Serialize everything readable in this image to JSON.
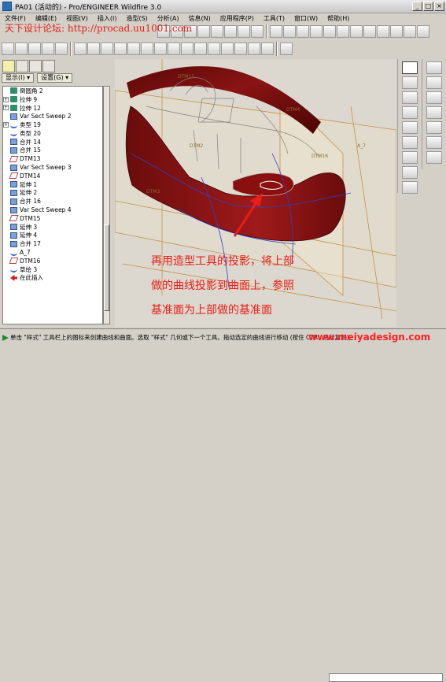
{
  "window": {
    "title": "PA01 (活动的) - Pro/ENGINEER Wildfire 3.0",
    "min_label": "_",
    "max_label": "□",
    "close_label": "×"
  },
  "menu": [
    "文件(F)",
    "编辑(E)",
    "视图(V)",
    "插入(I)",
    "造型(S)",
    "分析(A)",
    "信息(N)",
    "应用程序(P)",
    "工具(T)",
    "窗口(W)",
    "帮助(H)"
  ],
  "watermark_top": "天下设计论坛: http://procad.uu1001.com",
  "panel": {
    "display_label": "显示(I) ▾",
    "settings_label": "设置(G) ▾"
  },
  "tree": [
    {
      "label": "倒圆角 2",
      "icon": "feature-icon",
      "expander": ""
    },
    {
      "label": "拉伸 9",
      "icon": "extrude-icon",
      "expander": "+"
    },
    {
      "label": "拉伸 12",
      "icon": "extrude-icon",
      "expander": "+"
    },
    {
      "label": "Var Sect Sweep 2",
      "icon": "sweep-icon",
      "expander": ""
    },
    {
      "label": "类型 19",
      "icon": "style-icon",
      "expander": "+"
    },
    {
      "label": "类型 20",
      "icon": "style-icon",
      "expander": ""
    },
    {
      "label": "合并 14",
      "icon": "merge-icon",
      "expander": ""
    },
    {
      "label": "合并 15",
      "icon": "merge-icon",
      "expander": ""
    },
    {
      "label": "DTM13",
      "icon": "datum-plane-icon",
      "expander": ""
    },
    {
      "label": "Var Sect Sweep 3",
      "icon": "sweep-icon",
      "expander": ""
    },
    {
      "label": "DTM14",
      "icon": "datum-plane-icon",
      "expander": ""
    },
    {
      "label": "延伸 1",
      "icon": "extend-icon",
      "expander": ""
    },
    {
      "label": "延伸 2",
      "icon": "extend-icon",
      "expander": ""
    },
    {
      "label": "合并 16",
      "icon": "merge-icon",
      "expander": ""
    },
    {
      "label": "Var Sect Sweep 4",
      "icon": "sweep-icon",
      "expander": ""
    },
    {
      "label": "DTM15",
      "icon": "datum-plane-icon",
      "expander": ""
    },
    {
      "label": "延伸 3",
      "icon": "extend-icon",
      "expander": ""
    },
    {
      "label": "延伸 4",
      "icon": "extend-icon",
      "expander": ""
    },
    {
      "label": "合并 17",
      "icon": "merge-icon",
      "expander": ""
    },
    {
      "label": "A_7",
      "icon": "datum-axis-icon",
      "expander": ""
    },
    {
      "label": "DTM16",
      "icon": "datum-plane-icon",
      "expander": ""
    },
    {
      "label": "草绘 3",
      "icon": "sketch-icon",
      "expander": ""
    },
    {
      "label": "在此插入",
      "icon": "insert-here-icon",
      "expander": ""
    }
  ],
  "viewport": {
    "datum_labels": [
      "DTM15",
      "DTM4",
      "A_7",
      "DTM16",
      "DTM2",
      "DTM3"
    ]
  },
  "captions": [
    "再用造型工具的投影，将上部",
    "做的曲线投影到曲面上，参照",
    "基准面为上部做的基准面"
  ],
  "status": {
    "message": "单击 \"样式\" 工具栏上的图标来创建曲线和曲面。选取 \"样式\" 几何或下一个工具。拖动选定的曲线进行移动 (按住 CTRL 进行复制)。",
    "site": "www.meiyadesign.com"
  },
  "colors": {
    "car_body": "#7a1010",
    "caption_red": "#e81e14",
    "datum_orange": "#c89040"
  }
}
